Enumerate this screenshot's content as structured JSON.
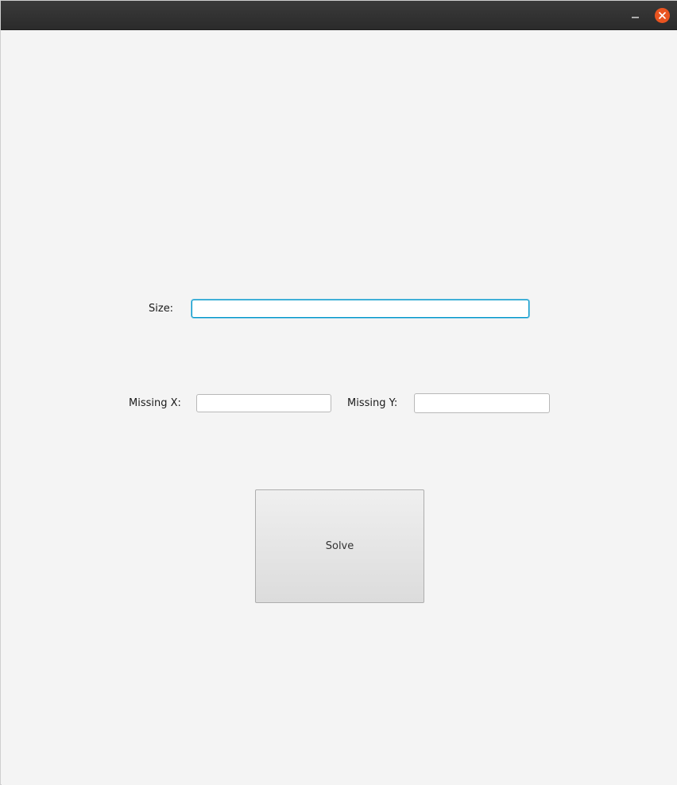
{
  "window": {
    "title": "",
    "controls": {
      "minimize_icon": "minimize-icon",
      "close_icon": "close-icon",
      "close_color": "#e95420"
    }
  },
  "form": {
    "size": {
      "label": "Size:",
      "value": "",
      "placeholder": ""
    },
    "missing_x": {
      "label": "Missing X:",
      "value": "",
      "placeholder": ""
    },
    "missing_y": {
      "label": "Missing Y:",
      "value": "",
      "placeholder": ""
    },
    "solve_button_label": "Solve"
  },
  "colors": {
    "focus_accent": "#0096c9",
    "background": "#f4f4f4",
    "titlebar": "#2b2b2b"
  }
}
